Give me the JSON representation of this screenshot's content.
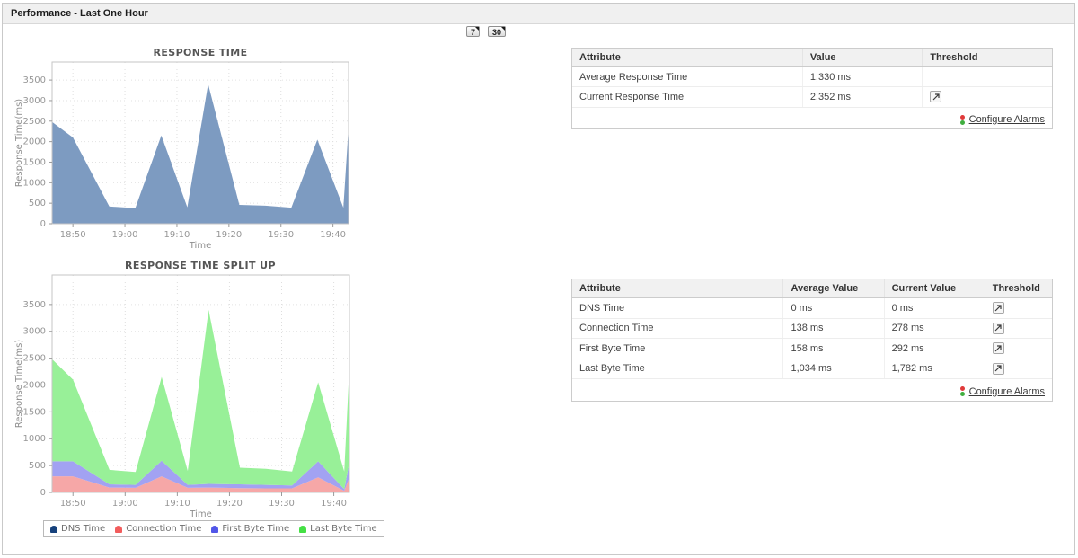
{
  "titlebar": {
    "title": "Performance - Last One Hour"
  },
  "toolbar": {
    "buttons": [
      {
        "id": "range-7",
        "label": "7"
      },
      {
        "id": "range-30",
        "label": "30"
      }
    ]
  },
  "tables": {
    "response_time": {
      "headers": [
        "Attribute",
        "Value",
        "Threshold"
      ],
      "col_widths": [
        "48%",
        "25%",
        "27%"
      ],
      "rows": [
        {
          "attribute": "Average Response Time",
          "values": [
            "1,330 ms"
          ],
          "threshold": false
        },
        {
          "attribute": "Current Response Time",
          "values": [
            "2,352 ms"
          ],
          "threshold": true
        }
      ],
      "footer": {
        "link": "Configure Alarms",
        "icon": "traffic-light-icon"
      }
    },
    "response_time_split_up": {
      "headers": [
        "Attribute",
        "Average Value",
        "Current Value",
        "Threshold"
      ],
      "col_widths": [
        "44%",
        "21%",
        "21%",
        "14%"
      ],
      "rows": [
        {
          "attribute": "DNS Time",
          "values": [
            "0 ms",
            "0 ms"
          ],
          "threshold": true
        },
        {
          "attribute": "Connection Time",
          "values": [
            "138 ms",
            "278 ms"
          ],
          "threshold": true
        },
        {
          "attribute": "First Byte Time",
          "values": [
            "158 ms",
            "292 ms"
          ],
          "threshold": true
        },
        {
          "attribute": "Last Byte Time",
          "values": [
            "1,034 ms",
            "1,782 ms"
          ],
          "threshold": true
        }
      ],
      "footer": {
        "link": "Configure Alarms",
        "icon": "traffic-light-icon"
      }
    }
  },
  "chart_data": [
    {
      "type": "area",
      "title": "RESPONSE TIME",
      "xlabel": "Time",
      "ylabel": "Response Time(ms)",
      "stacked": false,
      "grid": true,
      "x": [
        "18:46",
        "18:50",
        "18:57",
        "19:02",
        "19:07",
        "19:12",
        "19:16",
        "19:22",
        "19:27",
        "19:32",
        "19:37",
        "19:42",
        "19:43"
      ],
      "series": [
        {
          "name": "Response Time",
          "fill_color": "#7d9bc1",
          "values": [
            2480,
            2100,
            420,
            380,
            2150,
            400,
            3400,
            460,
            440,
            390,
            2050,
            390,
            2352
          ]
        }
      ],
      "xticks": [
        "18:50",
        "19:00",
        "19:10",
        "19:20",
        "19:30",
        "19:40"
      ],
      "yticks": [
        0,
        500,
        1000,
        1500,
        2000,
        2500,
        3000,
        3500
      ],
      "ylim": [
        0,
        3940
      ],
      "legend": null
    },
    {
      "type": "area",
      "title": "RESPONSE TIME SPLIT UP",
      "xlabel": "Time",
      "ylabel": "Response Time(ms)",
      "stacked": true,
      "grid": true,
      "x": [
        "18:46",
        "18:50",
        "18:57",
        "19:02",
        "19:07",
        "19:12",
        "19:16",
        "19:22",
        "19:27",
        "19:32",
        "19:37",
        "19:42",
        "19:43"
      ],
      "series": [
        {
          "name": "DNS Time",
          "fill_color": "#16417c",
          "legend_color": "#16417c",
          "values": [
            0,
            0,
            0,
            0,
            0,
            0,
            0,
            0,
            0,
            0,
            0,
            0,
            0
          ]
        },
        {
          "name": "Connection Time",
          "fill_color": "#f6a7a7",
          "legend_color": "#f25c5c",
          "values": [
            300,
            300,
            90,
            85,
            300,
            85,
            90,
            80,
            75,
            75,
            280,
            30,
            278
          ]
        },
        {
          "name": "First Byte Time",
          "fill_color": "#a2a2f2",
          "legend_color": "#5156e8",
          "values": [
            280,
            280,
            60,
            55,
            290,
            55,
            70,
            70,
            65,
            55,
            300,
            30,
            292
          ]
        },
        {
          "name": "Last Byte Time",
          "fill_color": "#98f098",
          "legend_color": "#44e044",
          "values": [
            1900,
            1520,
            270,
            240,
            1560,
            260,
            3240,
            310,
            300,
            260,
            1470,
            330,
            1782
          ]
        }
      ],
      "xticks": [
        "18:50",
        "19:00",
        "19:10",
        "19:20",
        "19:30",
        "19:40"
      ],
      "yticks": [
        0,
        500,
        1000,
        1500,
        2000,
        2500,
        3000,
        3500
      ],
      "ylim": [
        0,
        4050
      ],
      "legend": {
        "position": "bottom"
      }
    }
  ]
}
